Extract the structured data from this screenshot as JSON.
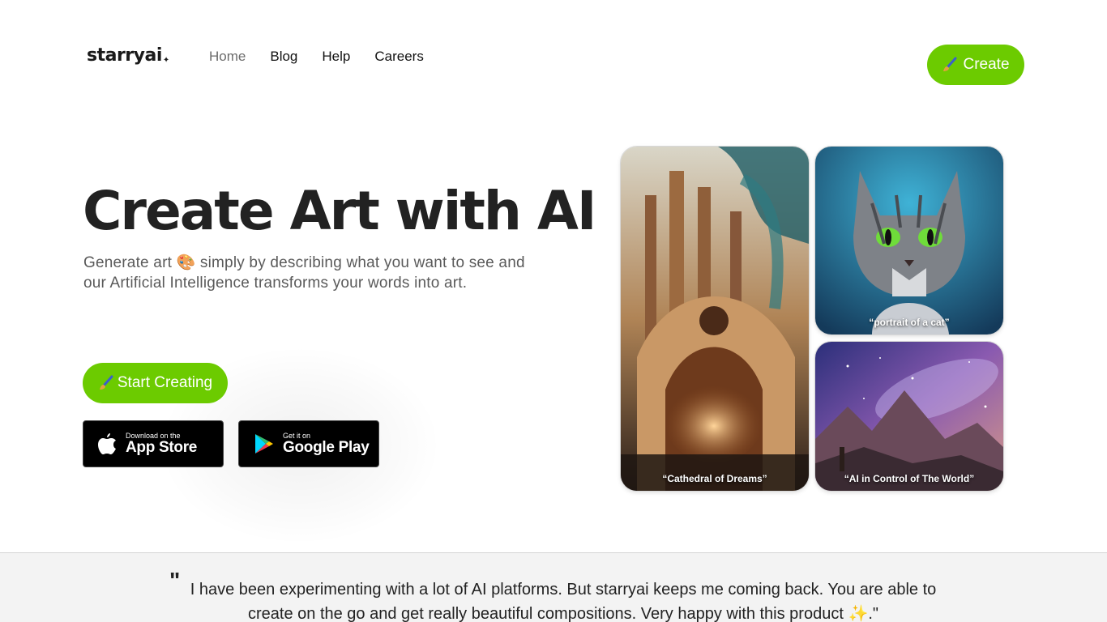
{
  "header": {
    "logo_text": "starryai",
    "logo_star": "✦",
    "nav": [
      {
        "label": "Home",
        "active": true
      },
      {
        "label": "Blog",
        "active": false
      },
      {
        "label": "Help",
        "active": false
      },
      {
        "label": "Careers",
        "active": false
      }
    ],
    "create_label": "Create",
    "create_icon": "paintbrush-icon"
  },
  "hero": {
    "title": "Create Art with AI",
    "subtitle_part1": "Generate art",
    "subtitle_emoji": "🎨",
    "subtitle_part2": "simply by describing what you want to see and our Artificial Intelligence transforms your words into art.",
    "start_label": "Start Creating",
    "start_icon": "paintbrush-icon",
    "app_store": {
      "small": "Download on the",
      "big": "App Store"
    },
    "google_play": {
      "small": "Get it on",
      "big": "Google Play"
    }
  },
  "gallery": [
    {
      "caption": "“Cathedral of Dreams”"
    },
    {
      "caption": "“portrait of a cat”"
    },
    {
      "caption": "“AI in Control of The World”"
    }
  ],
  "testimonial": {
    "quote_mark": "\"",
    "text": "I have been experimenting with a lot of AI platforms. But starryai keeps me coming back. You are able to create on the go and get really beautiful compositions. Very happy with this product ✨.\""
  },
  "colors": {
    "accent": "#6ccb00",
    "text": "#222222",
    "muted": "#5a5a5a",
    "testimonial_bg": "#f3f3f3"
  }
}
